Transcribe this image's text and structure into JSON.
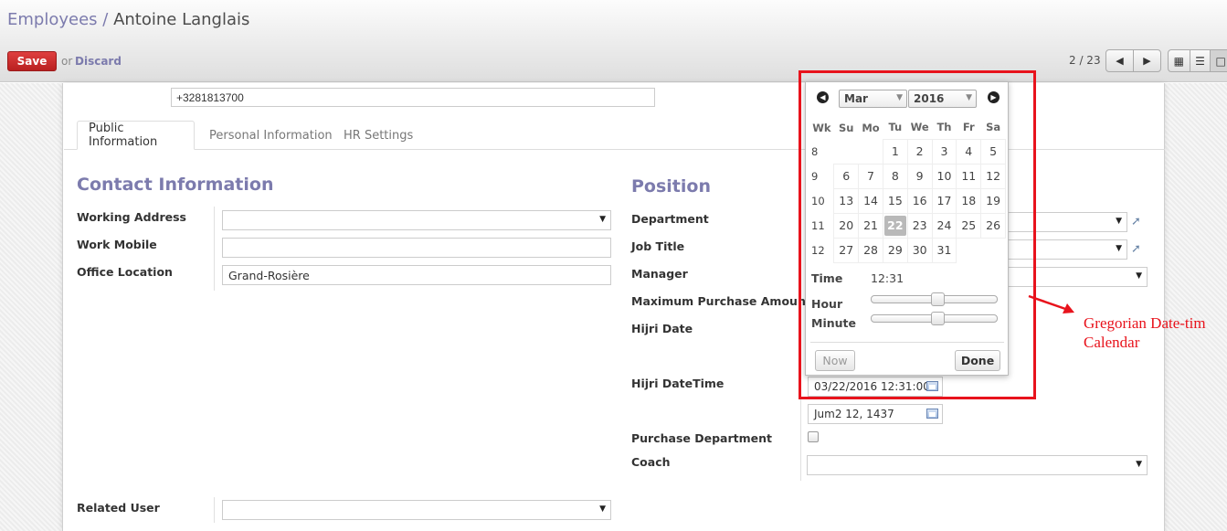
{
  "breadcrumb": {
    "parent": "Employees",
    "separator": "/",
    "current": "Antoine Langlais"
  },
  "toolbar": {
    "save_label": "Save",
    "or_text": "or",
    "discard_label": "Discard"
  },
  "pager": {
    "value": "2 / 23",
    "prev_icon": "arrow-left-icon",
    "next_icon": "arrow-right-icon"
  },
  "views": {
    "kanban_icon": "grid-icon",
    "list_icon": "list-icon",
    "form_icon": "form-icon",
    "active": "form"
  },
  "phone": {
    "value": "+3281813700"
  },
  "tabs": [
    {
      "label": "Public Information",
      "active": true
    },
    {
      "label": "Personal Information",
      "active": false
    },
    {
      "label": "HR Settings",
      "active": false
    }
  ],
  "contact": {
    "title": "Contact Information",
    "working_address_label": "Working Address",
    "working_address_value": "",
    "work_mobile_label": "Work Mobile",
    "work_mobile_value": "",
    "office_location_label": "Office Location",
    "office_location_value": "Grand-Rosière",
    "related_user_label": "Related User",
    "related_user_value": ""
  },
  "position": {
    "title": "Position",
    "department_label": "Department",
    "job_title_label": "Job Title",
    "manager_label": "Manager",
    "max_purchase_label": "Maximum Purchase Amount",
    "hijri_date_label": "Hijri Date",
    "hijri_datetime_label": "Hijri DateTime",
    "hijri_datetime_value": "03/22/2016 12:31:00",
    "hijri_date_value": "Jum2 12, 1437",
    "purchase_department_label": "Purchase Department",
    "purchase_department_checked": false,
    "coach_label": "Coach",
    "coach_value": ""
  },
  "datepicker": {
    "month": "Mar",
    "year": "2016",
    "prev_icon": "circle-arrow-left-icon",
    "next_icon": "circle-arrow-right-icon",
    "weekday_headers": [
      "Wk",
      "Su",
      "Mo",
      "Tu",
      "We",
      "Th",
      "Fr",
      "Sa"
    ],
    "weeks": [
      {
        "wk": "8",
        "days": [
          "",
          "",
          "1",
          "2",
          "3",
          "4",
          "5"
        ]
      },
      {
        "wk": "9",
        "days": [
          "6",
          "7",
          "8",
          "9",
          "10",
          "11",
          "12"
        ]
      },
      {
        "wk": "10",
        "days": [
          "13",
          "14",
          "15",
          "16",
          "17",
          "18",
          "19"
        ]
      },
      {
        "wk": "11",
        "days": [
          "20",
          "21",
          "22",
          "23",
          "24",
          "25",
          "26"
        ]
      },
      {
        "wk": "12",
        "days": [
          "27",
          "28",
          "29",
          "30",
          "31",
          "",
          ""
        ]
      }
    ],
    "selected_day": "22",
    "time_label": "Time",
    "time_value": "12:31",
    "hour_label": "Hour",
    "minute_label": "Minute",
    "hour_value": 12,
    "minute_value": 31,
    "now_label": "Now",
    "done_label": "Done"
  },
  "annotation": {
    "line1": "Gregorian Date-tim",
    "line2": "Calendar"
  },
  "colors": {
    "accent": "#7c7bad",
    "save": "#c9302c",
    "annotation": "#e8131c"
  }
}
